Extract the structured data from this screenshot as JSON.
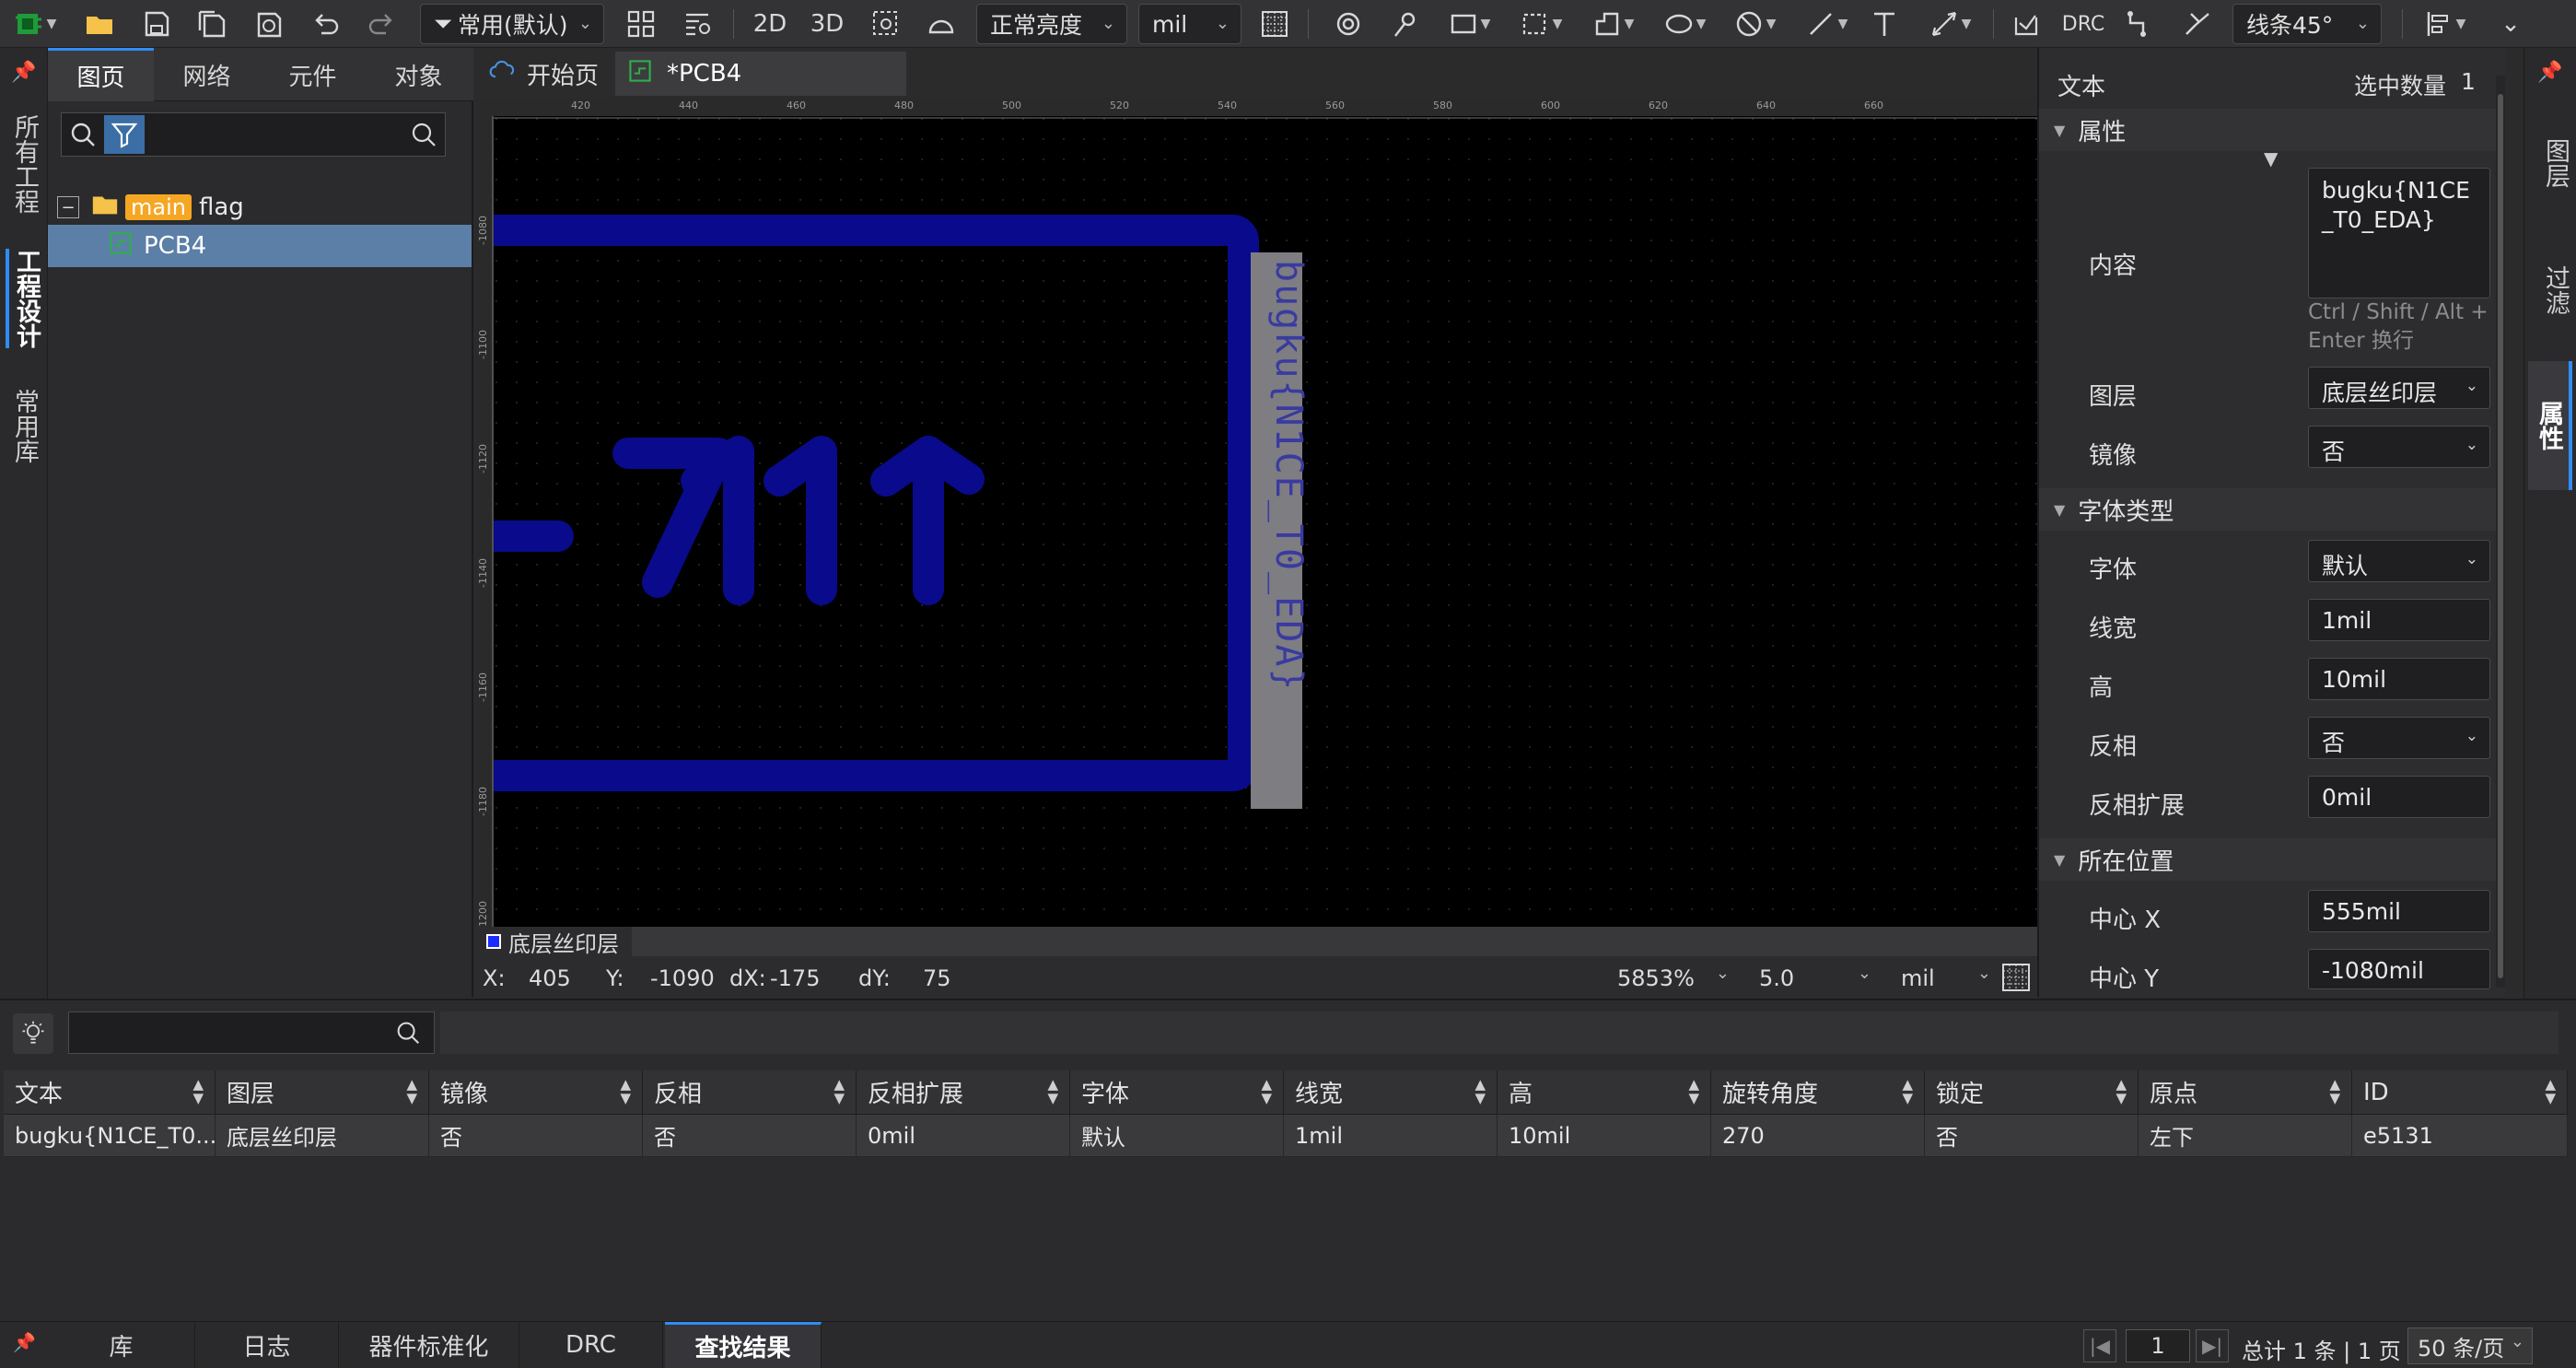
{
  "toolbar": {
    "filter_label": "常用(默认)",
    "view2d": "2D",
    "view3d": "3D",
    "brightness": "正常亮度",
    "unit": "mil",
    "drc": "DRC",
    "route_angle": "线条45°"
  },
  "left_strip": {
    "all_projects": "所有工程",
    "project_design": "工程设计",
    "common_lib": "常用库"
  },
  "project_panel": {
    "tabs": [
      "图页",
      "网络",
      "元件",
      "对象"
    ],
    "search_placeholder": "",
    "tree": {
      "root_tag": "main",
      "root_name": "flag",
      "child_name": "PCB4"
    }
  },
  "doc_tabs": {
    "start_page": "开始页",
    "pcb": "*PCB4"
  },
  "ruler": {
    "top_ticks": [
      "420",
      "440",
      "460",
      "480",
      "500",
      "520",
      "540",
      "560",
      "580",
      "600",
      "620",
      "640",
      "660"
    ],
    "left_ticks": [
      "-1080",
      "-1100",
      "-1120",
      "-1140",
      "-1160",
      "-1180",
      "-1200"
    ]
  },
  "canvas": {
    "silk_text": "bugku{N1CE_T0_EDA}",
    "pcb_color": "#0a0a8c"
  },
  "layer_bar": {
    "layer_name": "底层丝印层",
    "layer_color": "#1a2cff"
  },
  "status": {
    "x_label": "X:",
    "x_val": "405",
    "y_label": "Y:",
    "y_val": "-1090",
    "dx_label": "dX:",
    "dx_val": "-175",
    "dy_label": "dY:",
    "dy_val": "75",
    "zoom": "5853%",
    "grid": "5.0",
    "unit": "mil"
  },
  "properties": {
    "title": "文本",
    "selected_label": "选中数量",
    "selected_count": "1",
    "section_attr": "属性",
    "content_label": "内容",
    "content_value": "bugku{N1CE_T0_EDA}",
    "content_hint": "Ctrl / Shift / Alt + Enter 换行",
    "layer_label": "图层",
    "layer_value": "底层丝印层",
    "mirror_label": "镜像",
    "mirror_value": "否",
    "section_font": "字体类型",
    "font_label": "字体",
    "font_value": "默认",
    "linewidth_label": "线宽",
    "linewidth_value": "1mil",
    "height_label": "高",
    "height_value": "10mil",
    "invert_label": "反相",
    "invert_value": "否",
    "invert_ext_label": "反相扩展",
    "invert_ext_value": "0mil",
    "section_pos": "所在位置",
    "cx_label": "中心 X",
    "cx_value": "555mil",
    "cy_label": "中心 Y",
    "cy_value": "-1080mil"
  },
  "right_strip": {
    "layers": "图层",
    "filter": "过滤",
    "attributes": "属性"
  },
  "results": {
    "search_placeholder": "",
    "columns": [
      "文本",
      "图层",
      "镜像",
      "反相",
      "反相扩展",
      "字体",
      "线宽",
      "高",
      "旋转角度",
      "锁定",
      "原点",
      "ID"
    ],
    "rows": [
      [
        "bugku{N1CE_T0...",
        "底层丝印层",
        "否",
        "否",
        "0mil",
        "默认",
        "1mil",
        "10mil",
        "270",
        "否",
        "左下",
        "e5131"
      ]
    ]
  },
  "bottom_tabs": [
    "库",
    "日志",
    "器件标准化",
    "DRC",
    "查找结果"
  ],
  "pagination": {
    "page": "1",
    "summary": "总计 1 条 | 1 页",
    "per_page": "50 条/页"
  }
}
